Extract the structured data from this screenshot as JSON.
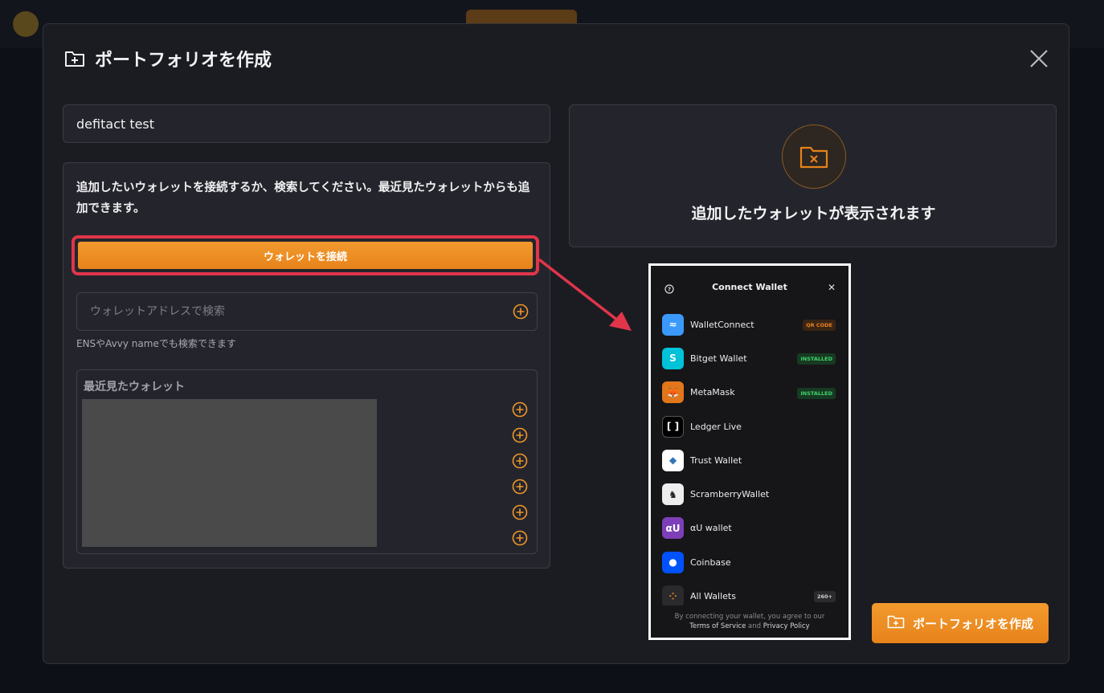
{
  "modal": {
    "title": "ポートフォリオを作成",
    "name_value": "defitact test"
  },
  "wallet_panel": {
    "instructions": "追加したいウォレットを接続するか、検索してください。最近見たウォレットからも追加できます。",
    "connect_label": "ウォレットを接続",
    "search_placeholder": "ウォレットアドレスで検索",
    "search_hint": "ENSやAvvy nameでも検索できます",
    "recent_title": "最近見たウォレット"
  },
  "preview": {
    "text": "追加したウォレットが表示されます"
  },
  "connect_wallet": {
    "title": "Connect Wallet",
    "items": [
      {
        "name": "WalletConnect",
        "badge": "QR CODE",
        "badge_type": "qr",
        "icon": "walletconnect-icon",
        "color": "#3b99fc"
      },
      {
        "name": "Bitget Wallet",
        "badge": "INSTALLED",
        "badge_type": "installed",
        "icon": "bitget-icon",
        "color": "#00c2d9"
      },
      {
        "name": "MetaMask",
        "badge": "INSTALLED",
        "badge_type": "installed",
        "icon": "metamask-icon",
        "color": "#e2761b"
      },
      {
        "name": "Ledger Live",
        "badge": "",
        "badge_type": "",
        "icon": "ledger-icon",
        "color": "#000000"
      },
      {
        "name": "Trust Wallet",
        "badge": "",
        "badge_type": "",
        "icon": "trust-wallet-icon",
        "color": "#ffffff"
      },
      {
        "name": "ScramberryWallet",
        "badge": "",
        "badge_type": "",
        "icon": "scramberry-icon",
        "color": "#eeeeee"
      },
      {
        "name": "αU wallet",
        "badge": "",
        "badge_type": "",
        "icon": "au-wallet-icon",
        "color": "#7d3fb8"
      },
      {
        "name": "Coinbase",
        "badge": "",
        "badge_type": "",
        "icon": "coinbase-icon",
        "color": "#0052ff"
      },
      {
        "name": "All Wallets",
        "badge": "260+",
        "badge_type": "count",
        "icon": "all-wallets-icon",
        "color": "#2a2a2d"
      }
    ],
    "footer_line1": "By connecting your wallet, you agree to our",
    "footer_terms": "Terms of Service",
    "footer_and": "and",
    "footer_privacy": "Privacy Policy"
  },
  "create_button": {
    "label": "ポートフォリオを作成"
  },
  "colors": {
    "accent": "#e7831a",
    "highlight": "#e0354a",
    "modal_bg": "#1b1c22"
  }
}
